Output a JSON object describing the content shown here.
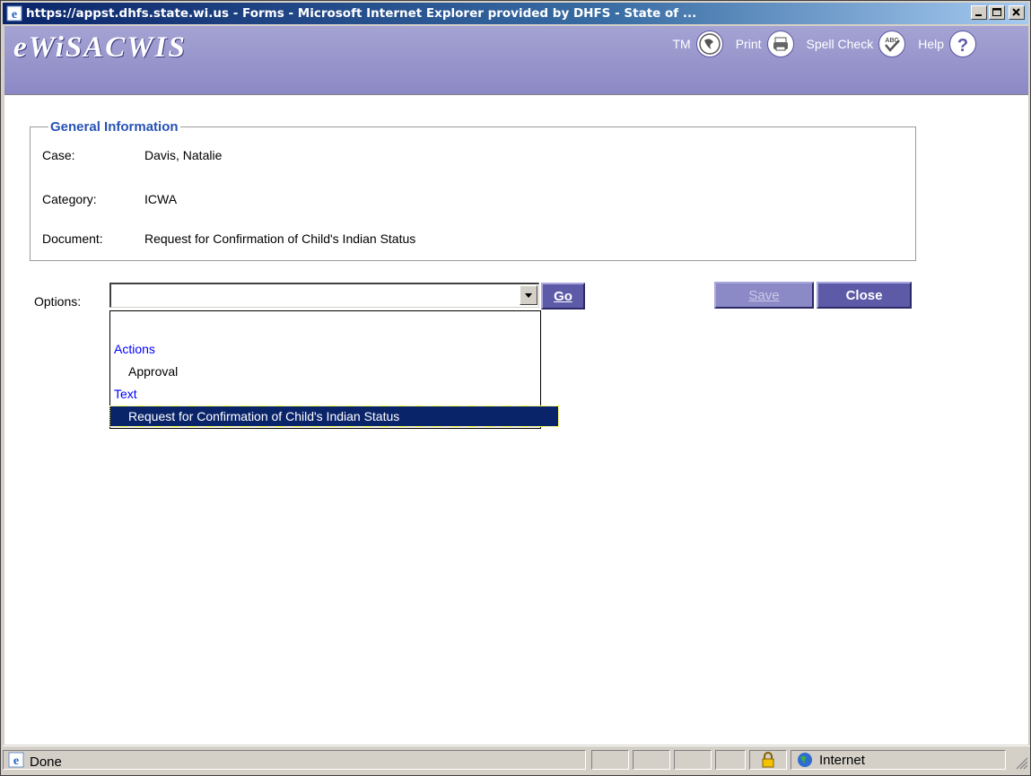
{
  "window": {
    "title": "https://appst.dhfs.state.wi.us - Forms - Microsoft Internet Explorer provided by DHFS - State of ..."
  },
  "app": {
    "logo": "eWiSACWIS",
    "tools": [
      {
        "label": "TM",
        "icon": "tm-globe-icon"
      },
      {
        "label": "Print",
        "icon": "printer-icon"
      },
      {
        "label": "Spell Check",
        "icon": "spell-check-icon"
      },
      {
        "label": "Help",
        "icon": "help-icon"
      }
    ]
  },
  "general_information": {
    "legend": "General Information",
    "case_label": "Case:",
    "case_value": "Davis, Natalie",
    "category_label": "Category:",
    "category_value": "ICWA",
    "document_label": "Document:",
    "document_value": "Request for Confirmation of Child's Indian Status"
  },
  "options": {
    "label": "Options:",
    "selected_value": "",
    "dropdown": [
      {
        "type": "blank",
        "text": ""
      },
      {
        "type": "group",
        "text": "Actions"
      },
      {
        "type": "option",
        "text": "Approval"
      },
      {
        "type": "group",
        "text": "Text"
      },
      {
        "type": "option",
        "text": "Request for Confirmation of Child's Indian Status",
        "highlighted": true
      }
    ]
  },
  "buttons": {
    "go": "Go",
    "save": "Save",
    "close": "Close"
  },
  "statusbar": {
    "status": "Done",
    "zone": "Internet"
  },
  "colors": {
    "header": "#8b88c5",
    "button": "#5d5aa8",
    "legend": "#2752b5",
    "group_text": "#0000ff",
    "selection": "#0a246a"
  }
}
